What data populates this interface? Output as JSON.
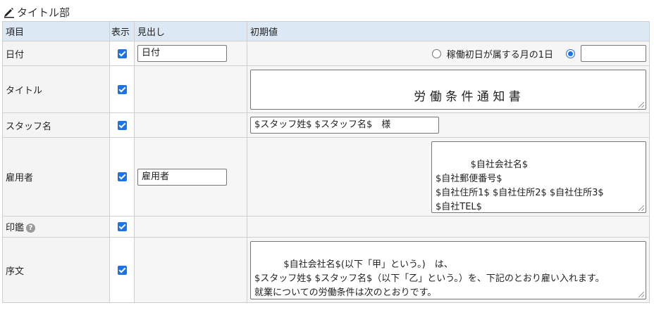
{
  "section": {
    "title": "タイトル部",
    "icon": "pencil-icon"
  },
  "columns": {
    "item": "項目",
    "show": "表示",
    "heading": "見出し",
    "initial": "初期値"
  },
  "rows": {
    "date": {
      "label": "日付",
      "show": true,
      "heading_value": "日付",
      "radio_option_label": "稼働初日が属する月の1日",
      "radio_option_selected": false,
      "custom_selected": true,
      "custom_value": ""
    },
    "title": {
      "label": "タイトル",
      "show": true,
      "initial_value": "労 働 条 件 通 知 書"
    },
    "staff": {
      "label": "スタッフ名",
      "show": true,
      "initial_value": "$スタッフ姓$ $スタッフ名$　様"
    },
    "employer": {
      "label": "雇用者",
      "show": true,
      "heading_value": "雇用者",
      "initial_value": "$自社会社名$\n$自社郵便番号$\n$自社住所1$ $自社住所2$ $自社住所3$\n$自社TEL$"
    },
    "seal": {
      "label": "印鑑",
      "show": true,
      "help_icon": "question-circle-icon"
    },
    "preface": {
      "label": "序文",
      "show": true,
      "initial_value": "$自社会社名$(以下「甲」という。)　は、\n$スタッフ姓$ $スタッフ名$（以下「乙」という。）を、下記のとおり雇い入れます。\n就業についての労働条件は次のとおりです。"
    }
  },
  "colors": {
    "header_bg": "#dce9f5",
    "accent": "#1a73e8",
    "border": "#cfcfcf"
  }
}
